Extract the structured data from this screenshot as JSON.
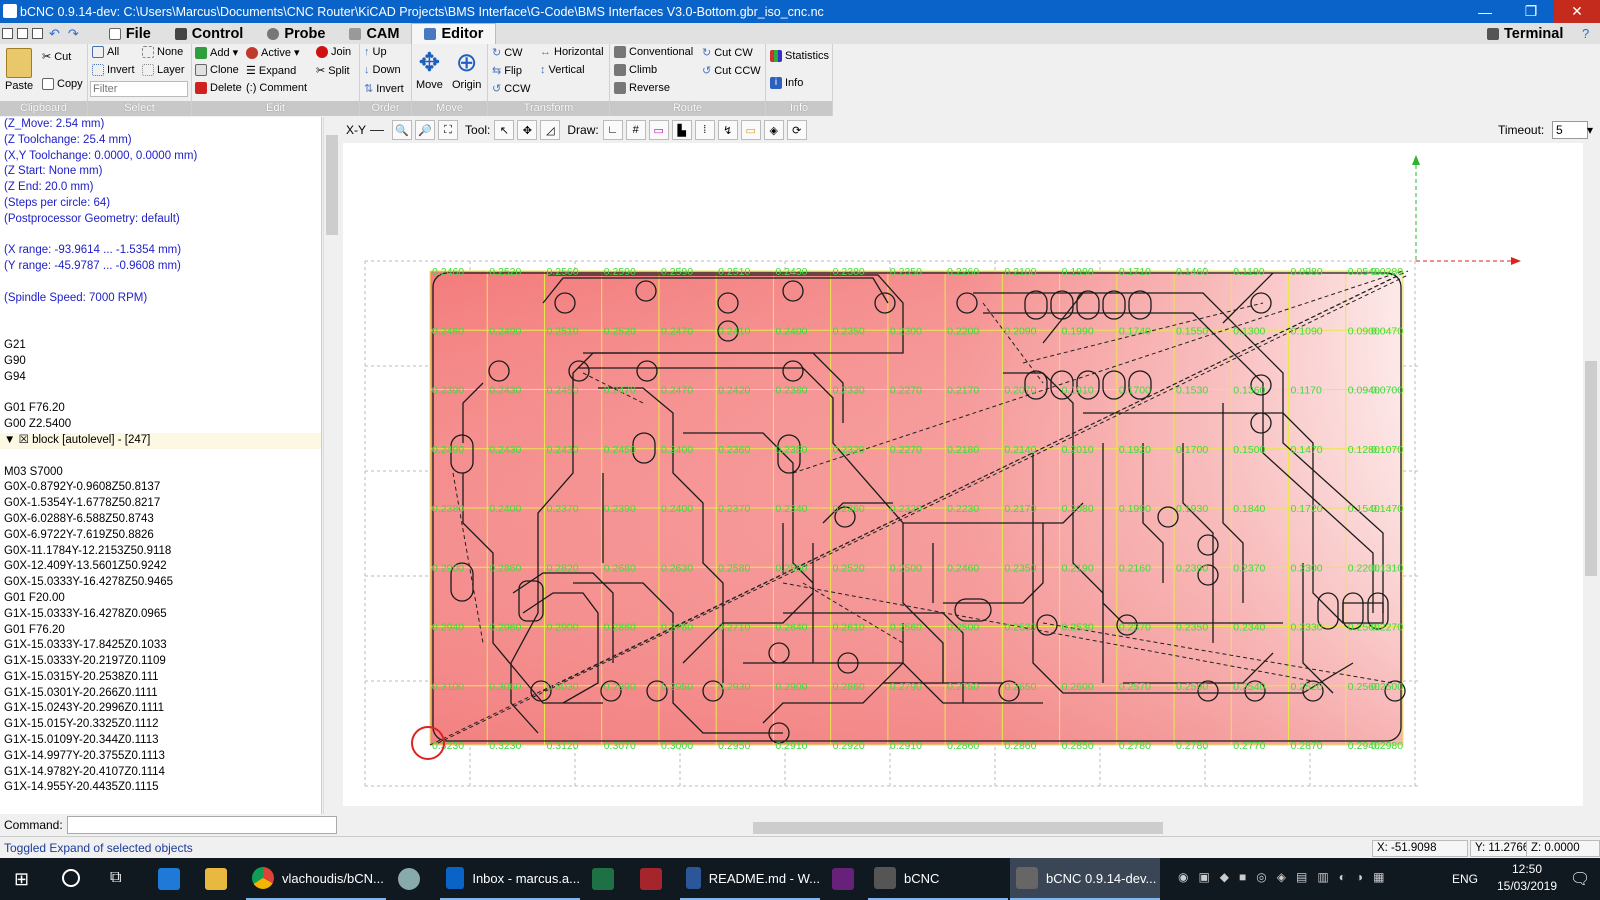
{
  "window": {
    "title": "bCNC 0.9.14-dev: C:\\Users\\Marcus\\Documents\\CNC Router\\KiCAD Projects\\BMS Interface\\G-Code\\BMS Interfaces V3.0-Bottom.gbr_iso_cnc.nc",
    "minimize": "—",
    "maximize": "❐",
    "close": "✕"
  },
  "menu": {
    "tabs": [
      {
        "label": "File",
        "icon": "file-icon"
      },
      {
        "label": "Control",
        "icon": "control-icon"
      },
      {
        "label": "Probe",
        "icon": "probe-icon"
      },
      {
        "label": "CAM",
        "icon": "cam-icon"
      },
      {
        "label": "Editor",
        "icon": "editor-icon",
        "active": true
      }
    ],
    "terminal": "Terminal"
  },
  "ribbon": {
    "clipboard": {
      "label": "Clipboard",
      "paste": "Paste",
      "cut": "Cut",
      "copy": "Copy"
    },
    "select": {
      "label": "Select",
      "all": "All",
      "none": "None",
      "invert": "Invert",
      "layer": "Layer",
      "filter_placeholder": "Filter"
    },
    "edit": {
      "label": "Edit",
      "add": "Add",
      "active": "Active",
      "join": "Join",
      "clone": "Clone",
      "expand": "Expand",
      "split": "Split",
      "delete": "Delete",
      "comment": "Comment"
    },
    "order": {
      "label": "Order",
      "up": "Up",
      "down": "Down",
      "invert": "Invert"
    },
    "move": {
      "label": "Move",
      "move": "Move",
      "origin": "Origin"
    },
    "transform": {
      "label": "Transform",
      "cw": "CW",
      "flip": "Flip",
      "ccw": "CCW",
      "horizontal": "Horizontal",
      "vertical": "Vertical"
    },
    "route": {
      "label": "Route",
      "conventional": "Conventional",
      "climb": "Climb",
      "reverse": "Reverse",
      "cut_cw": "Cut CW",
      "cut_ccw": "Cut CCW"
    },
    "info": {
      "label": "Info",
      "statistics": "Statistics",
      "info": "Info"
    }
  },
  "code": {
    "lines": [
      {
        "text": "(Z_Move: 2.54 mm)",
        "color": "blue"
      },
      {
        "text": "(Z Toolchange: 25.4 mm)",
        "color": "blue"
      },
      {
        "text": "(X,Y Toolchange: 0.0000, 0.0000 mm)",
        "color": "blue"
      },
      {
        "text": "(Z Start: None mm)",
        "color": "blue"
      },
      {
        "text": "(Z End: 20.0 mm)",
        "color": "blue"
      },
      {
        "text": "(Steps per circle: 64)",
        "color": "blue"
      },
      {
        "text": "(Postprocessor Geometry: default)",
        "color": "blue"
      },
      {
        "text": "",
        "color": "blue"
      },
      {
        "text": "(X range:  -93.9614 ...  -1.5354  mm)",
        "color": "blue"
      },
      {
        "text": "(Y range:  -45.9787 ...  -0.9608  mm)",
        "color": "blue"
      },
      {
        "text": "",
        "color": "blue"
      },
      {
        "text": "(Spindle Speed: 7000 RPM)",
        "color": "blue"
      },
      {
        "text": "",
        "color": "black"
      },
      {
        "text": "",
        "color": "black"
      },
      {
        "text": "G21",
        "color": "black"
      },
      {
        "text": "G90",
        "color": "black"
      },
      {
        "text": "G94",
        "color": "black"
      },
      {
        "text": "",
        "color": "black"
      },
      {
        "text": "G01 F76.20",
        "color": "black"
      },
      {
        "text": "G00 Z2.5400",
        "color": "black"
      },
      {
        "text": "▼ ☒ block [autolevel] - [247]",
        "color": "block"
      },
      {
        "text": "",
        "color": "black"
      },
      {
        "text": "M03 S7000",
        "color": "black"
      },
      {
        "text": "G0X-0.8792Y-0.9608Z50.8137",
        "color": "black"
      },
      {
        "text": "G0X-1.5354Y-1.6778Z50.8217",
        "color": "black"
      },
      {
        "text": "G0X-6.0288Y-6.588Z50.8743",
        "color": "black"
      },
      {
        "text": "G0X-6.9722Y-7.619Z50.8826",
        "color": "black"
      },
      {
        "text": "G0X-11.1784Y-12.2153Z50.9118",
        "color": "black"
      },
      {
        "text": "G0X-12.409Y-13.5601Z50.9242",
        "color": "black"
      },
      {
        "text": "G0X-15.0333Y-16.4278Z50.9465",
        "color": "black"
      },
      {
        "text": "G01 F20.00",
        "color": "black"
      },
      {
        "text": "G1X-15.0333Y-16.4278Z0.0965",
        "color": "black"
      },
      {
        "text": "G01 F76.20",
        "color": "black"
      },
      {
        "text": "G1X-15.0333Y-17.8425Z0.1033",
        "color": "black"
      },
      {
        "text": "G1X-15.0333Y-20.2197Z0.1109",
        "color": "black"
      },
      {
        "text": "G1X-15.0315Y-20.2538Z0.111",
        "color": "black"
      },
      {
        "text": "G1X-15.0301Y-20.266Z0.1111",
        "color": "black"
      },
      {
        "text": "G1X-15.0243Y-20.2996Z0.1111",
        "color": "black"
      },
      {
        "text": "G1X-15.015Y-20.3325Z0.1112",
        "color": "black"
      },
      {
        "text": "G1X-15.0109Y-20.344Z0.1113",
        "color": "black"
      },
      {
        "text": "G1X-14.9977Y-20.3755Z0.1113",
        "color": "black"
      },
      {
        "text": "G1X-14.9782Y-20.4107Z0.1114",
        "color": "black"
      },
      {
        "text": "G1X-14.955Y-20.4435Z0.1115",
        "color": "black"
      }
    ]
  },
  "command": {
    "label": "Command:"
  },
  "canvas_toolbar": {
    "view": "X-Y",
    "tool_label": "Tool:",
    "draw_label": "Draw:",
    "timeout_label": "Timeout:",
    "timeout_value": "5"
  },
  "autolevel": {
    "row_labels": [
      [
        "0.2460",
        "0.2520",
        "0.2560",
        "0.2590",
        "0.2590",
        "0.2510",
        "0.2430",
        "0.2380",
        "0.2350",
        "0.2260",
        "0.2100",
        "0.1990",
        "0.1710",
        "0.1460",
        "0.1190",
        "0.0980",
        "0.0540",
        "0.0280"
      ],
      [
        "0.2460",
        "0.2490",
        "0.2510",
        "0.2520",
        "0.2470",
        "0.2410",
        "0.2400",
        "0.2350",
        "0.2300",
        "0.2200",
        "0.2090",
        "0.1990",
        "0.1740",
        "0.1550",
        "0.1300",
        "0.1090",
        "0.0900",
        "0.0470"
      ],
      [
        "0.2390",
        "0.2430",
        "0.2450",
        "0.2470",
        "0.2470",
        "0.2420",
        "0.2380",
        "0.2330",
        "0.2270",
        "0.2170",
        "0.2070",
        "0.1910",
        "0.1700",
        "0.1530",
        "0.1360",
        "0.1170",
        "0.0940",
        "0.0700"
      ],
      [
        "0.2490",
        "0.2430",
        "0.2430",
        "0.2450",
        "0.2400",
        "0.2360",
        "0.2350",
        "0.2320",
        "0.2270",
        "0.2180",
        "0.2140",
        "0.2010",
        "0.1920",
        "0.1700",
        "0.1500",
        "0.1470",
        "0.1280",
        "0.1070"
      ],
      [
        "0.2380",
        "0.2400",
        "0.2370",
        "0.2390",
        "0.2400",
        "0.2370",
        "0.2340",
        "0.2360",
        "0.2320",
        "0.2230",
        "0.2170",
        "0.2080",
        "0.1990",
        "0.1930",
        "0.1840",
        "0.1720",
        "0.1540",
        "0.1470"
      ],
      [
        "0.2900",
        "0.2860",
        "0.2820",
        "0.2680",
        "0.2630",
        "0.2580",
        "0.2550",
        "0.2520",
        "0.2500",
        "0.2460",
        "0.2350",
        "0.2190",
        "0.2160",
        "0.2390",
        "0.2370",
        "0.2300",
        "0.2200",
        "0.1310"
      ],
      [
        "0.2940",
        "0.2960",
        "0.2900",
        "0.2860",
        "0.2780",
        "0.2710",
        "0.2640",
        "0.2610",
        "0.2560",
        "0.2500",
        "0.2530",
        "0.2530",
        "0.2370",
        "0.2350",
        "0.2340",
        "0.2330",
        "0.2560",
        "0.2270"
      ],
      [
        "0.3100",
        "0.3060",
        "0.3030",
        "0.2990",
        "0.2950",
        "0.2930",
        "0.2900",
        "0.2860",
        "0.2790",
        "0.2750",
        "0.2650",
        "0.2600",
        "0.2570",
        "0.2590",
        "0.2540",
        "0.2520",
        "0.2560",
        "0.2500"
      ],
      [
        "0.3230",
        "0.3230",
        "0.3120",
        "0.3070",
        "0.3000",
        "0.2950",
        "0.2910",
        "0.2920",
        "0.2910",
        "0.2860",
        "0.2860",
        "0.2850",
        "0.2780",
        "0.2780",
        "0.2770",
        "0.2870",
        "0.2940",
        "0.2980"
      ]
    ]
  },
  "status": {
    "message": "Toggled Expand of selected objects",
    "x": "X: -51.9098",
    "y": "Y: 11.2766",
    "z": "Z: 0.0000"
  },
  "taskbar": {
    "items": [
      {
        "label": "vlachoudis/bCN...",
        "icon": "chrome-icon"
      },
      {
        "label": "Inbox - marcus.a...",
        "icon": "outlook-icon"
      },
      {
        "label": "README.md - W...",
        "icon": "word-icon"
      },
      {
        "label": "bCNC",
        "icon": "bcnc-icon"
      },
      {
        "label": "bCNC 0.9.14-dev...",
        "icon": "bcnc-icon"
      }
    ],
    "lang": "ENG",
    "time": "12:50",
    "date": "15/03/2019"
  }
}
